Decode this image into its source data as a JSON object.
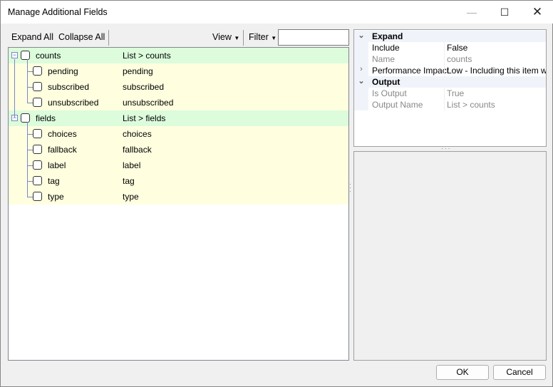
{
  "window": {
    "title": "Manage Additional Fields"
  },
  "toolbar": {
    "expand_all": "Expand All",
    "collapse_all": "Collapse All",
    "view": "View",
    "filter": "Filter",
    "filter_value": ""
  },
  "tree": [
    {
      "label": "counts",
      "value": "List > counts",
      "children": [
        {
          "label": "pending",
          "value": "pending"
        },
        {
          "label": "subscribed",
          "value": "subscribed"
        },
        {
          "label": "unsubscribed",
          "value": "unsubscribed"
        }
      ]
    },
    {
      "label": "fields",
      "value": "List > fields",
      "children": [
        {
          "label": "choices",
          "value": "choices"
        },
        {
          "label": "fallback",
          "value": "fallback"
        },
        {
          "label": "label",
          "value": "label"
        },
        {
          "label": "tag",
          "value": "tag"
        },
        {
          "label": "type",
          "value": "type"
        }
      ]
    }
  ],
  "properties": {
    "expand": {
      "category": "Expand",
      "include_name": "Include",
      "include_value": "False",
      "name_name": "Name",
      "name_value": "counts",
      "perf_name": "Performance Impact",
      "perf_value": "Low - Including this item will h"
    },
    "output": {
      "category": "Output",
      "is_output_name": "Is Output",
      "is_output_value": "True",
      "output_name_name": "Output Name",
      "output_name_value": "List > counts"
    }
  },
  "buttons": {
    "ok": "OK",
    "cancel": "Cancel"
  }
}
